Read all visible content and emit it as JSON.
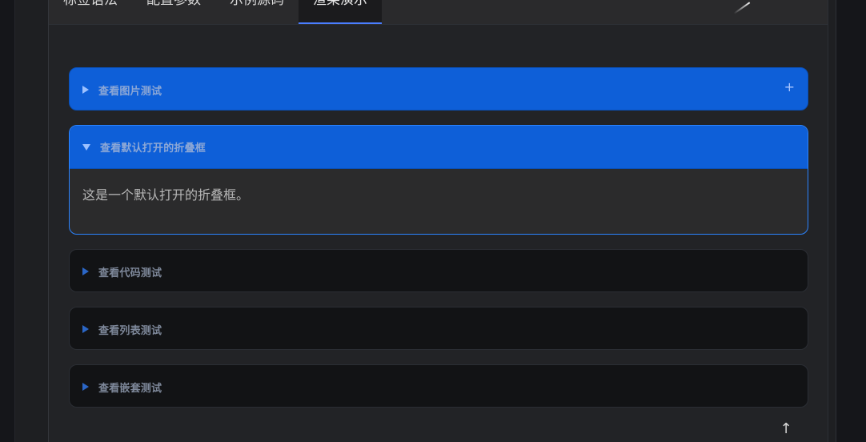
{
  "tabs": {
    "items": [
      {
        "label": "标签语法"
      },
      {
        "label": "配置参数"
      },
      {
        "label": "示例源码"
      },
      {
        "label": "渲染演示"
      }
    ],
    "active_index": 3
  },
  "panels": [
    {
      "title": "查看图片测试",
      "state": "collapsed",
      "accent": "#0e5fd8",
      "indicator": "+"
    },
    {
      "title": "查看默认打开的折叠框",
      "state": "expanded",
      "accent": "#0e5fd8",
      "content": "这是一个默认打开的折叠框。"
    },
    {
      "title": "查看代码测试",
      "state": "collapsed",
      "accent": "#121315"
    },
    {
      "title": "查看列表测试",
      "state": "collapsed",
      "accent": "#121315"
    },
    {
      "title": "查看嵌套测试",
      "state": "collapsed",
      "accent": "#121315"
    }
  ],
  "scroll_top": {
    "icon": "arrow-up-icon"
  }
}
